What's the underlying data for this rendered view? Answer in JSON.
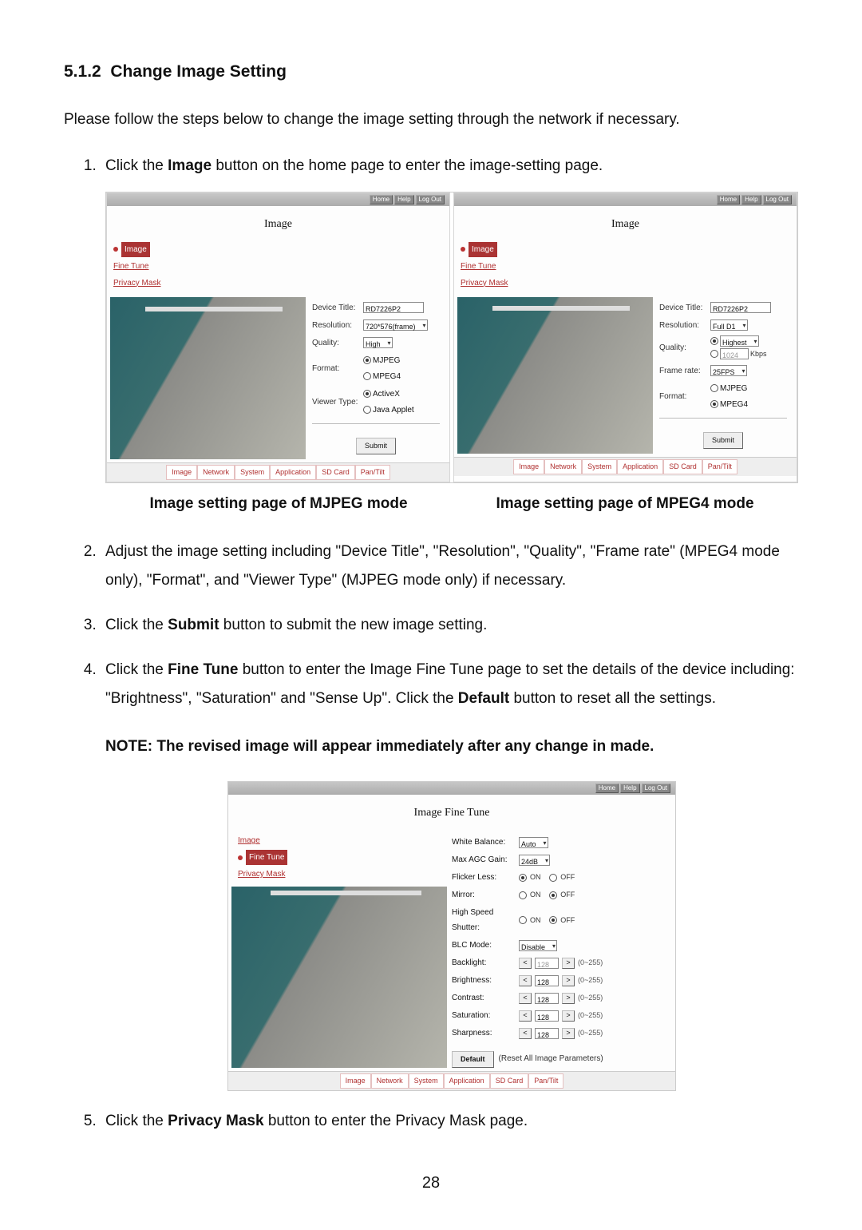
{
  "section": {
    "number": "5.1.2",
    "title": "Change Image Setting"
  },
  "intro": "Please follow the steps below to change the image setting through the network if necessary.",
  "steps": {
    "s1_pre": "Click the ",
    "s1_bold": "Image",
    "s1_post": " button on the home page to enter the image-setting page.",
    "cap_left": "Image setting page of MJPEG mode",
    "cap_right": "Image setting page of MPEG4 mode",
    "s2": "Adjust the image setting including \"Device Title\", \"Resolution\", \"Quality\", \"Frame rate\" (MPEG4 mode only), \"Format\", and \"Viewer Type\" (MJPEG mode only) if necessary.",
    "s3_pre": "Click the ",
    "s3_bold": "Submit",
    "s3_post": " button to submit the new image setting.",
    "s4_a_pre": "Click the ",
    "s4_a_bold": "Fine Tune",
    "s4_a_post": " button to enter the Image Fine Tune page to set the details of the device including: \"Brightness\", \"Saturation\" and \"Sense Up\". Click the ",
    "s4_b_bold": "Default",
    "s4_b_post": " button to reset all the settings.",
    "note": "NOTE: The revised image will appear immediately after any change in made.",
    "s5_pre": "Click the ",
    "s5_bold": "Privacy Mask",
    "s5_post": " button to enter the Privacy Mask page."
  },
  "top_buttons": {
    "home": "Home",
    "help": "Help",
    "logout": "Log Out"
  },
  "sidebar": {
    "image": "Image",
    "fine": "Fine Tune",
    "privacy": "Privacy Mask"
  },
  "tabs": {
    "image": "Image",
    "network": "Network",
    "system": "System",
    "application": "Application",
    "sdcard": "SD Card",
    "pantilt": "Pan/Tilt"
  },
  "panel_title": "Image",
  "mjpeg": {
    "device_title_l": "Device Title:",
    "device_title_v": "RD7226P2",
    "resolution_l": "Resolution:",
    "resolution_v": "720*576(frame)",
    "quality_l": "Quality:",
    "quality_v": "High",
    "format_l": "Format:",
    "format_o1": "MJPEG",
    "format_o2": "MPEG4",
    "viewer_l": "Viewer Type:",
    "viewer_o1": "ActiveX",
    "viewer_o2": "Java Applet",
    "submit": "Submit"
  },
  "mpeg4": {
    "device_title_l": "Device Title:",
    "device_title_v": "RD7226P2",
    "resolution_l": "Resolution:",
    "resolution_v": "Full D1",
    "quality_l": "Quality:",
    "quality_v": "Highest",
    "quality_extra": "1024",
    "quality_unit": "Kbps",
    "frame_l": "Frame rate:",
    "frame_v": "25FPS",
    "format_l": "Format:",
    "format_o1": "MJPEG",
    "format_o2": "MPEG4",
    "submit": "Submit"
  },
  "ft": {
    "title": "Image Fine Tune",
    "wb_l": "White Balance:",
    "wb_v": "Auto",
    "agc_l": "Max AGC Gain:",
    "agc_v": "24dB",
    "flicker_l": "Flicker Less:",
    "on": "ON",
    "off": "OFF",
    "mirror_l": "Mirror:",
    "hspeed_l": "High Speed Shutter:",
    "blc_l": "BLC Mode:",
    "blc_v": "Disable",
    "backlight_l": "Backlight:",
    "val128": "128",
    "range": "(0~255)",
    "brightness_l": "Brightness:",
    "contrast_l": "Contrast:",
    "saturation_l": "Saturation:",
    "sharpness_l": "Sharpness:",
    "lt": "<",
    "gt": ">",
    "default_btn": "Default",
    "default_txt": "(Reset All Image Parameters)"
  },
  "page_number": "28"
}
